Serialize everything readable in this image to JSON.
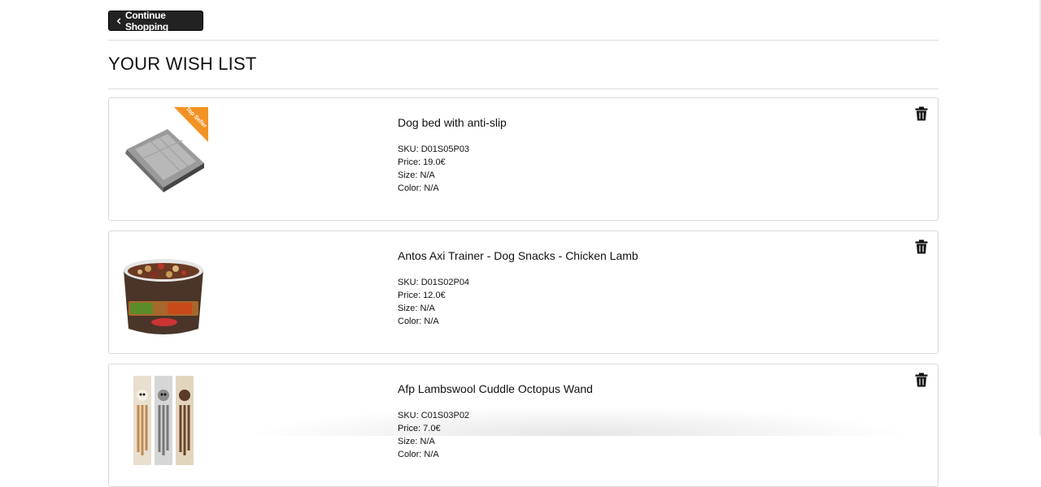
{
  "page": {
    "continue_label": "Continue Shopping",
    "title": "YOUR WISH LIST"
  },
  "items": [
    {
      "name": "Dog bed with anti-slip",
      "badge": "Top Seller",
      "sku": "SKU: D01S05P03",
      "price": "Price: 19.0€",
      "size": "Size: N/A",
      "color": "Color: N/A",
      "image_icon": "dog-bed-icon"
    },
    {
      "name": "Antos Axi Trainer - Dog Snacks - Chicken Lamb",
      "sku": "SKU: D01S02P04",
      "price": "Price: 12.0€",
      "size": "Size: N/A",
      "color": "Color: N/A",
      "image_icon": "snack-tub-icon"
    },
    {
      "name": "Afp Lambswool Cuddle Octopus Wand",
      "sku": "SKU: C01S03P02",
      "price": "Price: 7.0€",
      "size": "Size: N/A",
      "color": "Color: N/A",
      "image_icon": "octopus-wand-icon"
    }
  ],
  "colors": {
    "button_bg": "#222222",
    "badge": "#f39224",
    "card_border": "#d9d9d9"
  }
}
